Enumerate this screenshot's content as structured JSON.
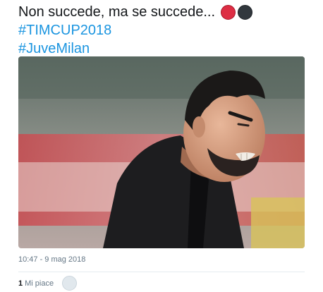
{
  "tweet": {
    "text_line_1": "Non succede, ma se succede...",
    "emoji": [
      {
        "name": "red-circle-emoji",
        "color": "#dd2e44"
      },
      {
        "name": "black-circle-emoji",
        "color": "#31373d"
      }
    ],
    "hashtags": [
      "#TIMCUP2018",
      "#JuveMilan"
    ],
    "hashtag_color": "#1b95e0"
  },
  "media": {
    "description": "photo-manager-angry-grimace"
  },
  "meta": {
    "timestamp": "10:47 - 9 mag 2018",
    "likes_count": "1",
    "likes_label": "Mi piace"
  }
}
